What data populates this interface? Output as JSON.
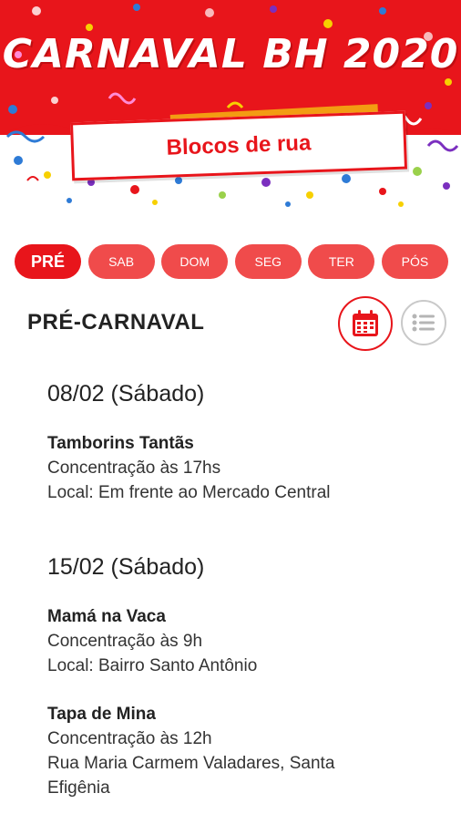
{
  "header": {
    "app_title": "CARNAVAL BH  2020",
    "subtitle": "Blocos de rua",
    "colors": {
      "brand_red": "#e8151b",
      "tab_red": "#f04b4b",
      "orange": "#f39c12"
    }
  },
  "tabs": [
    {
      "label": "PRÉ",
      "active": true
    },
    {
      "label": "SAB",
      "active": false
    },
    {
      "label": "DOM",
      "active": false
    },
    {
      "label": "SEG",
      "active": false
    },
    {
      "label": "TER",
      "active": false
    },
    {
      "label": "PÓS",
      "active": false
    }
  ],
  "section": {
    "title": "PRÉ-CARNAVAL",
    "calendar_icon": "calendar-icon",
    "list_icon": "list-icon"
  },
  "days": [
    {
      "date": "08/02 (Sábado)",
      "events": [
        {
          "name": "Tamborins Tantãs",
          "lines": [
            "Concentração às 17hs",
            "Local: Em frente ao Mercado Central"
          ]
        }
      ]
    },
    {
      "date": "15/02 (Sábado)",
      "events": [
        {
          "name": "Mamá na Vaca",
          "lines": [
            "Concentração às 9h",
            "Local: Bairro Santo Antônio"
          ]
        },
        {
          "name": "Tapa de Mina",
          "lines": [
            "Concentração às 12h",
            "Rua Maria Carmem Valadares, Santa",
            "Efigênia"
          ]
        }
      ]
    }
  ]
}
